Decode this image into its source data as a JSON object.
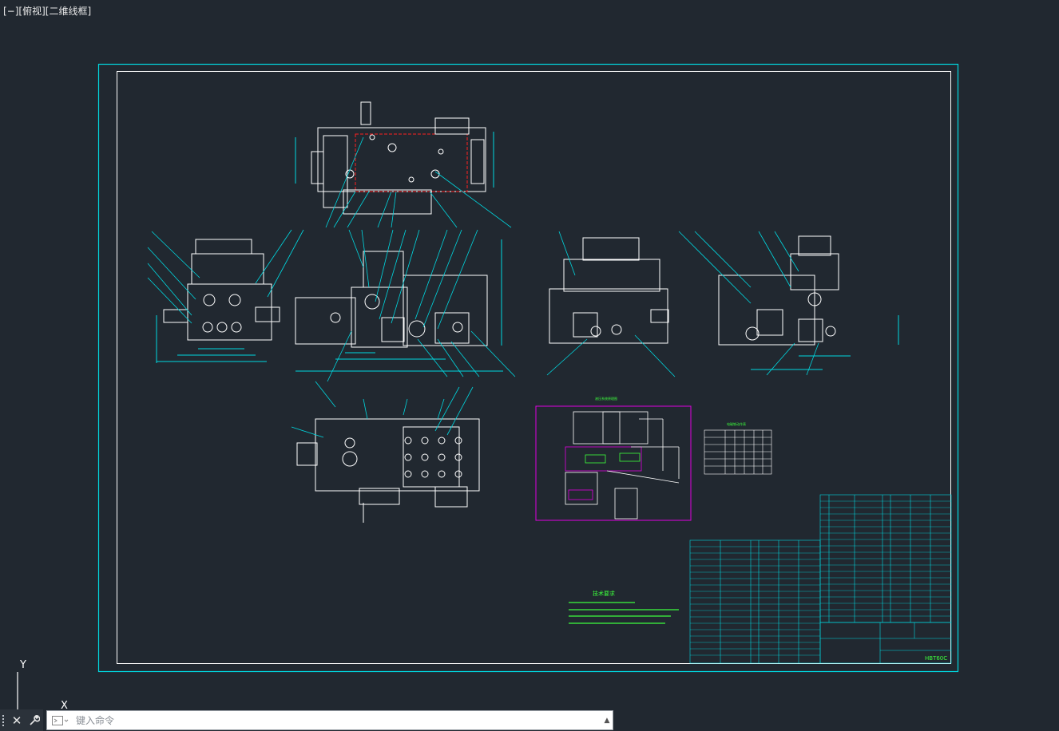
{
  "viewport": {
    "label": "[−][俯视][二维线框]"
  },
  "drawing": {
    "tech_title": "技术要求",
    "model_label": "HBT60C",
    "hyd_title": "液压系统原理图",
    "table_title": "电磁铁动作表"
  },
  "ucs": {
    "y_label": "Y",
    "x_label": "X"
  },
  "command": {
    "placeholder": "键入命令",
    "close_glyph": "✕",
    "tool_glyph": "🔧",
    "history_glyph": "▲"
  },
  "colors": {
    "background": "#212830",
    "cyan": "#00d8e0",
    "white": "#ffffff",
    "green": "#3cff3c",
    "magenta": "#e000e0",
    "red": "#ff2020"
  }
}
